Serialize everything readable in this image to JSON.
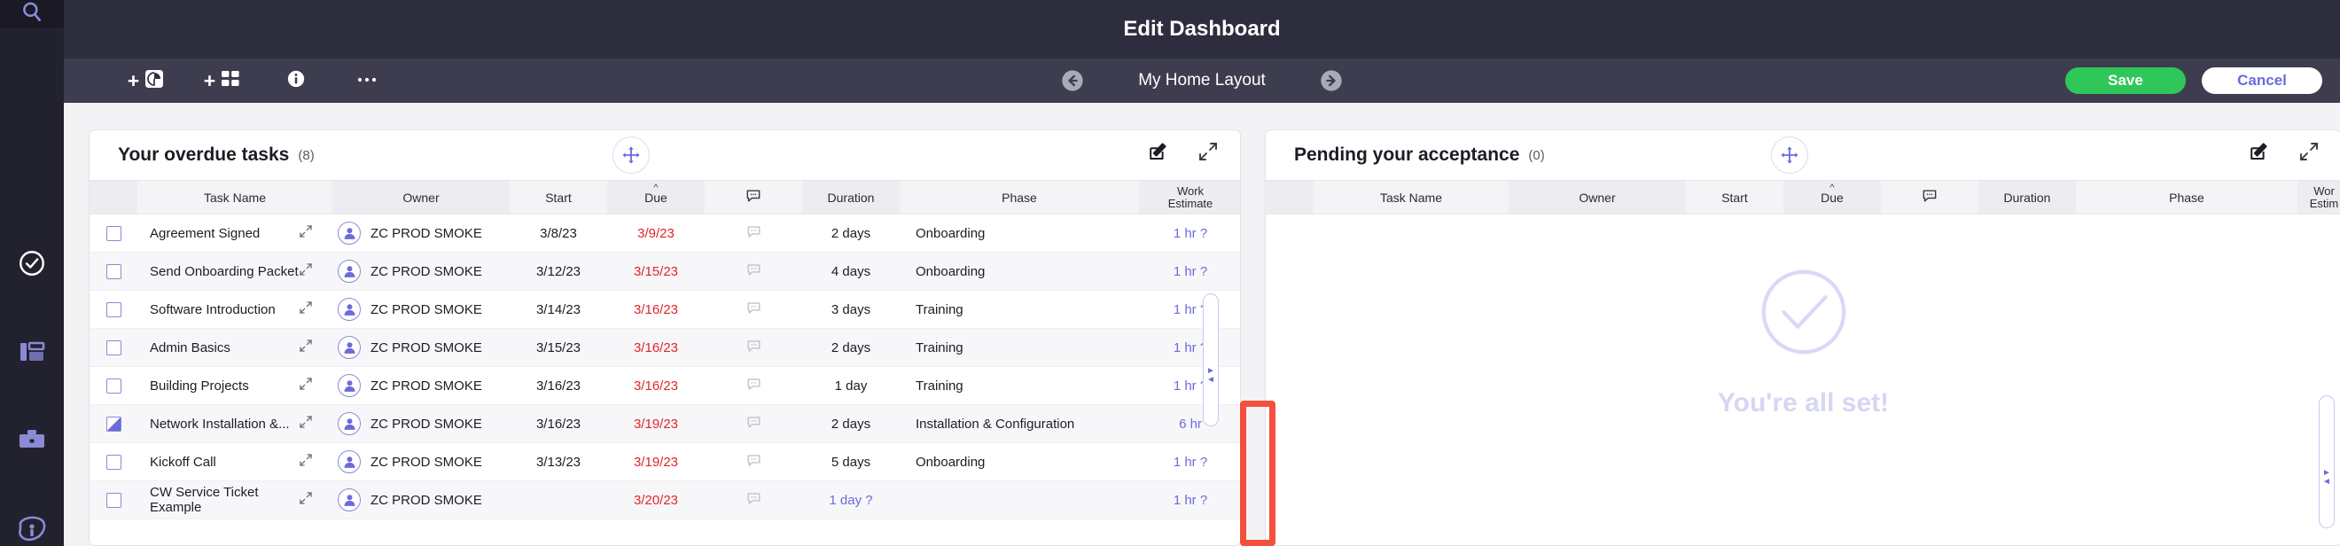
{
  "colors": {
    "rail_bg": "#22212e",
    "topbar_bg": "#2e2d3e",
    "subbar_bg": "#3e3d4f",
    "accent_purple": "#6c6bdb",
    "save_green": "#2fc75a",
    "overdue_red": "#e2232b",
    "annotation_red": "#f4503c"
  },
  "rail": {
    "search_icon": "search-icon",
    "items": [
      {
        "icon": "check-circle-icon",
        "active": true
      },
      {
        "icon": "dashboard-layout-icon",
        "active": false
      },
      {
        "icon": "briefcase-icon",
        "active": false
      },
      {
        "icon": "company-logo-icon",
        "active": false
      }
    ]
  },
  "topbar": {
    "title": "Edit Dashboard"
  },
  "subbar": {
    "add_chart_label": "+",
    "add_chart_icon": "pie-chart-icon",
    "add_widget_label": "+",
    "add_widget_icon": "grid-widget-icon",
    "info_icon": "info-icon",
    "more_icon": "more-horizontal-icon",
    "prev_icon": "arrow-left-circle-icon",
    "next_icon": "arrow-right-circle-icon",
    "layout_name": "My Home Layout",
    "save_label": "Save",
    "cancel_label": "Cancel"
  },
  "widgets": [
    {
      "title": "Your overdue tasks",
      "count": "(8)",
      "drag_icon": "move-handle-icon",
      "edit_icon": "edit-pencil-icon",
      "expand_icon": "expand-diagonal-icon",
      "columns": [
        {
          "key": "chk",
          "label": ""
        },
        {
          "key": "task",
          "label": "Task Name"
        },
        {
          "key": "owner",
          "label": "Owner"
        },
        {
          "key": "start",
          "label": "Start"
        },
        {
          "key": "due",
          "label": "Due",
          "sort": "asc"
        },
        {
          "key": "cmt",
          "label": "",
          "icon": "comment-icon"
        },
        {
          "key": "dur",
          "label": "Duration"
        },
        {
          "key": "phase",
          "label": "Phase"
        },
        {
          "key": "we",
          "label_line1": "Work",
          "label_line2": "Estimate"
        }
      ],
      "rows": [
        {
          "checked": "none",
          "task": "Agreement Signed",
          "owner": "ZC PROD SMOKE",
          "start": "3/8/23",
          "due": "3/9/23",
          "duration": "2 days",
          "phase": "Onboarding",
          "estimate": "1 hr ?"
        },
        {
          "checked": "none",
          "task": "Send Onboarding Packet",
          "owner": "ZC PROD SMOKE",
          "start": "3/12/23",
          "due": "3/15/23",
          "duration": "4 days",
          "phase": "Onboarding",
          "estimate": "1 hr ?"
        },
        {
          "checked": "none",
          "task": "Software Introduction",
          "owner": "ZC PROD SMOKE",
          "start": "3/14/23",
          "due": "3/16/23",
          "duration": "3 days",
          "phase": "Training",
          "estimate": "1 hr ?"
        },
        {
          "checked": "none",
          "task": "Admin Basics",
          "owner": "ZC PROD SMOKE",
          "start": "3/15/23",
          "due": "3/16/23",
          "duration": "2 days",
          "phase": "Training",
          "estimate": "1 hr ?"
        },
        {
          "checked": "none",
          "task": "Building Projects",
          "owner": "ZC PROD SMOKE",
          "start": "3/16/23",
          "due": "3/16/23",
          "duration": "1 day",
          "phase": "Training",
          "estimate": "1 hr ?"
        },
        {
          "checked": "partial",
          "task": "Network Installation &...",
          "owner": "ZC PROD SMOKE",
          "start": "3/16/23",
          "due": "3/19/23",
          "duration": "2 days",
          "phase": "Installation & Configuration",
          "estimate": "6 hr"
        },
        {
          "checked": "none",
          "task": "Kickoff Call",
          "owner": "ZC PROD SMOKE",
          "start": "3/13/23",
          "due": "3/19/23",
          "duration": "5 days",
          "phase": "Onboarding",
          "estimate": "1 hr ?"
        },
        {
          "checked": "none",
          "task": "CW Service Ticket Example",
          "owner": "ZC PROD SMOKE",
          "start": "",
          "due": "3/20/23",
          "duration": "1 day ?",
          "duration_estimated": true,
          "phase": "",
          "estimate": "1 hr ?"
        }
      ]
    },
    {
      "title": "Pending your acceptance",
      "count": "(0)",
      "drag_icon": "move-handle-icon",
      "edit_icon": "edit-pencil-icon",
      "expand_icon": "expand-diagonal-icon",
      "columns": [
        {
          "key": "chk",
          "label": ""
        },
        {
          "key": "task",
          "label": "Task Name"
        },
        {
          "key": "owner",
          "label": "Owner"
        },
        {
          "key": "start",
          "label": "Start"
        },
        {
          "key": "due",
          "label": "Due",
          "sort": "asc"
        },
        {
          "key": "cmt",
          "label": "",
          "icon": "comment-icon"
        },
        {
          "key": "dur",
          "label": "Duration"
        },
        {
          "key": "phase",
          "label": "Phase"
        },
        {
          "key": "we",
          "label_line1": "Wor",
          "label_line2": "Estim"
        }
      ],
      "rows": [],
      "empty_state": {
        "icon": "check-circle-outline-icon",
        "text": "You're all set!"
      }
    }
  ],
  "annotation": {
    "shape": "rectangle-highlight",
    "target": "vertical-scrollbar"
  }
}
